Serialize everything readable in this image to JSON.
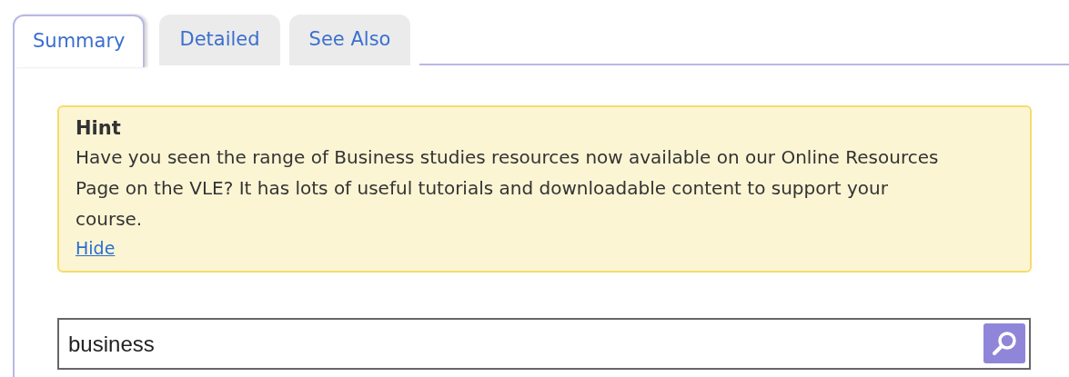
{
  "tabs": [
    {
      "label": "Summary",
      "selected": true
    },
    {
      "label": "Detailed",
      "selected": false
    },
    {
      "label": "See Also",
      "selected": false
    }
  ],
  "hint": {
    "title": "Hint",
    "text": "Have you seen the range of Business studies resources now available on our Online Resources Page on the VLE? It has lots of useful tutorials and downloadable content to support your course.",
    "link": "Hide"
  },
  "search": {
    "value": "business"
  }
}
